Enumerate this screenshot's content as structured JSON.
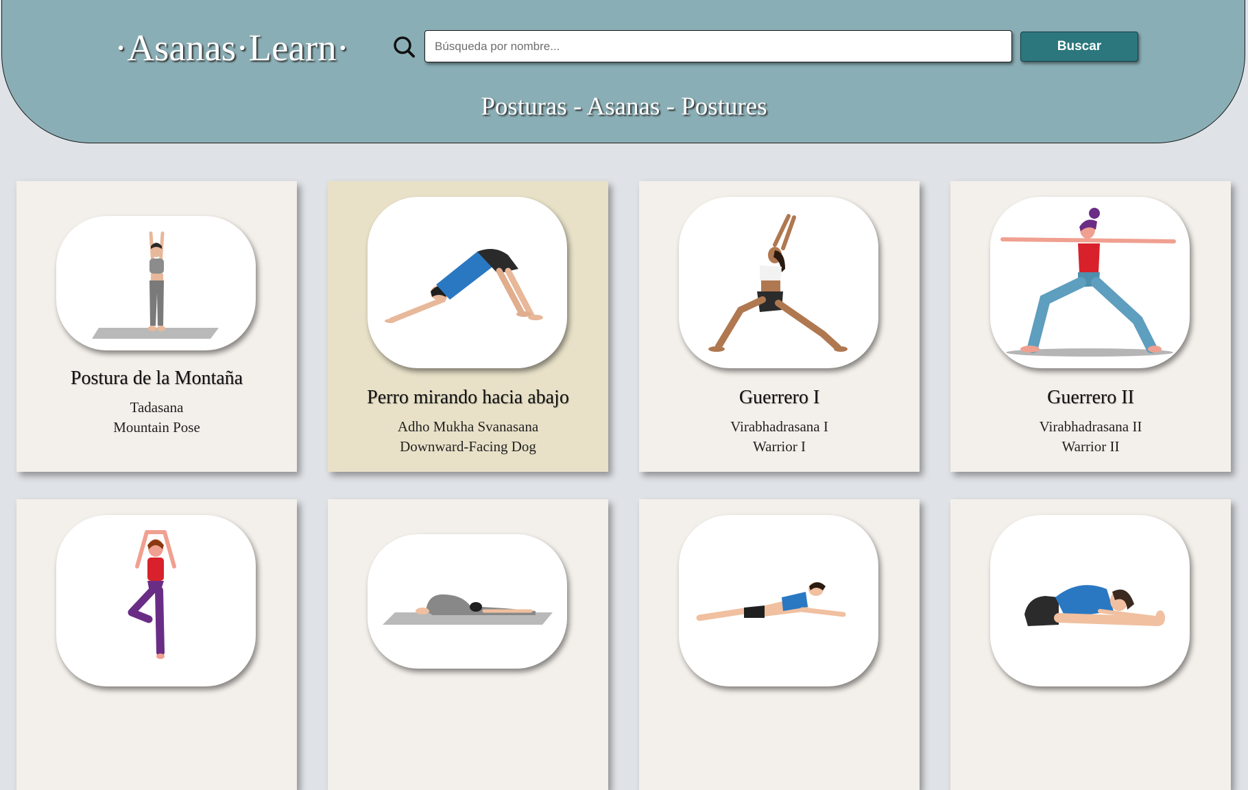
{
  "header": {
    "logo": "·Asanas·Learn·",
    "subtitle": "Posturas - Asanas - Postures",
    "search": {
      "placeholder": "Búsqueda por nombre...",
      "value": "",
      "button_label": "Buscar",
      "icon": "search-icon"
    }
  },
  "colors": {
    "header_bg": "#8aaeb5",
    "page_bg": "#dfe2e6",
    "card_bg": "#f3efea",
    "card_hover_bg": "#e8e1c8",
    "button_bg": "#2b777d"
  },
  "poses": [
    {
      "name": "Postura de la Montaña",
      "sanskrit": "Tadasana",
      "english": "Mountain Pose",
      "illustration": "mountain-pose-illustration"
    },
    {
      "name": "Perro mirando hacia abajo",
      "sanskrit": "Adho Mukha Svanasana",
      "english": "Downward-Facing Dog",
      "illustration": "downward-dog-illustration",
      "highlighted": true
    },
    {
      "name": "Guerrero I",
      "sanskrit": "Virabhadrasana I",
      "english": "Warrior I",
      "illustration": "warrior-1-illustration"
    },
    {
      "name": "Guerrero II",
      "sanskrit": "Virabhadrasana II",
      "english": "Warrior II",
      "illustration": "warrior-2-illustration"
    },
    {
      "name": "",
      "sanskrit": "",
      "english": "",
      "illustration": "tree-pose-illustration"
    },
    {
      "name": "",
      "sanskrit": "",
      "english": "",
      "illustration": "child-pose-illustration"
    },
    {
      "name": "",
      "sanskrit": "",
      "english": "",
      "illustration": "sphinx-pose-illustration"
    },
    {
      "name": "",
      "sanskrit": "",
      "english": "",
      "illustration": "seated-forward-bend-illustration"
    }
  ]
}
